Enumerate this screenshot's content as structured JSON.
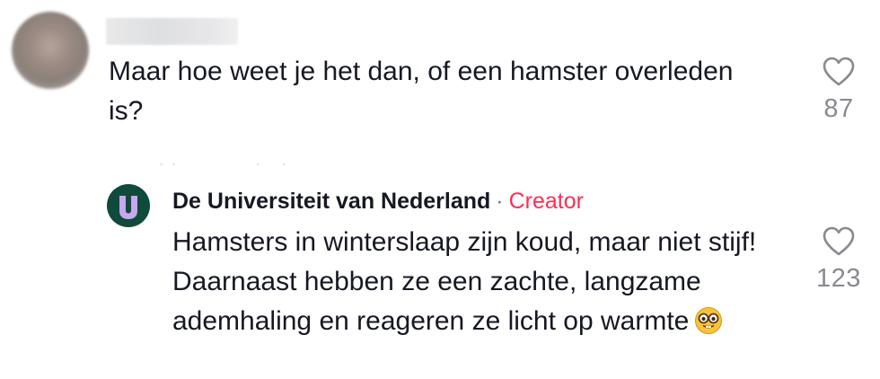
{
  "comment": {
    "text": "Maar hoe weet je het dan, of een hamster overleden is?",
    "likes": "87"
  },
  "reply": {
    "author": "De Universiteit van Nederland",
    "separator": "·",
    "badge": "Creator",
    "text": "Hamsters in winterslaap zijn koud, maar niet stijf! Daarnaast hebben ze een zachte, langzame ademhaling en reageren ze licht op warmte",
    "emoji": "nerd-face-emoji",
    "likes": "123"
  },
  "icons": {
    "like": "heart-icon",
    "creator_logo": "universiteit-logo"
  },
  "colors": {
    "creator_badge": "#fe2c55",
    "logo_bg": "#0f4a3a",
    "logo_letter": "#c9a6f0",
    "like_count": "#8a8b91"
  }
}
